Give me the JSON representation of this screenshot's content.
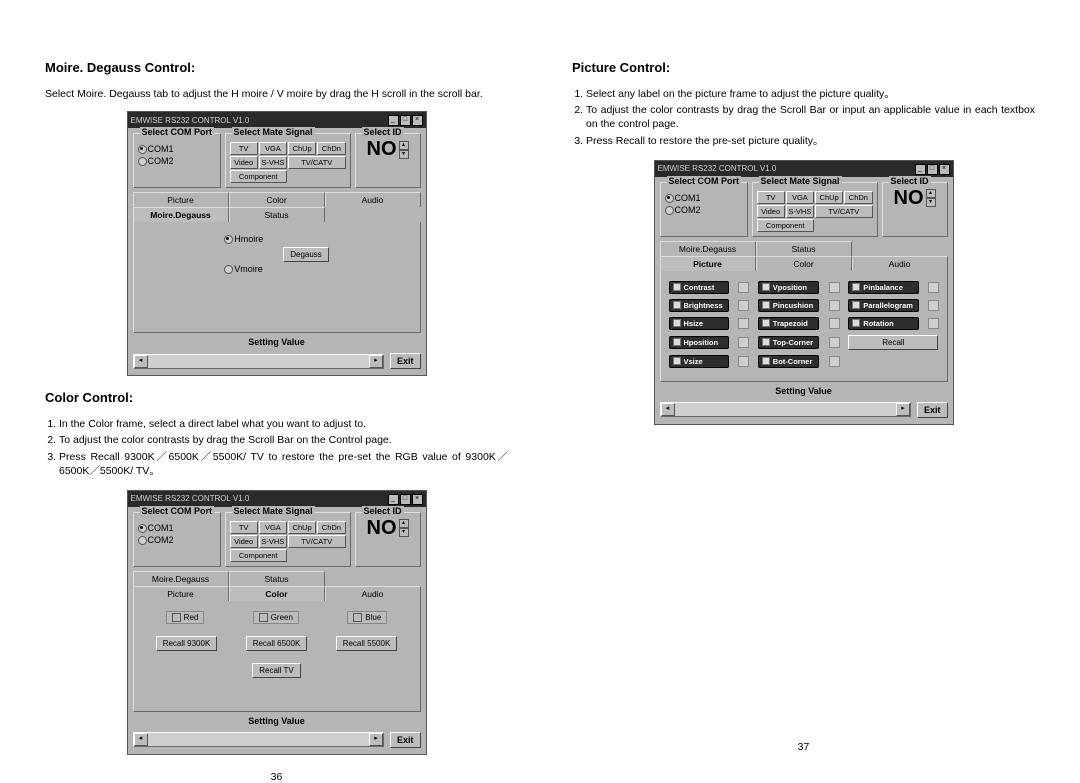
{
  "left_page": {
    "moire": {
      "heading": "Moire. Degauss Control:",
      "body": "Select Moire. Degauss tab to adjust the H moire / V moire by drag the H scroll in the scroll bar."
    },
    "color": {
      "heading": "Color Control:",
      "steps": [
        "In the Color frame, select a direct label what you want to adjust to.",
        "To adjust the color contrasts by drag the Scroll Bar on the Control page.",
        "Press Recall 9300K／6500K／5500K/ TV to restore the pre-set the RGB value of 9300K／6500K／5500K/ TV。"
      ]
    },
    "page_number": "36"
  },
  "right_page": {
    "picture": {
      "heading": "Picture Control:",
      "steps": [
        "Select any label on the picture frame to adjust the picture quality。",
        "To adjust the color contrasts by drag the Scroll Bar or input an applicable value in each textbox on the control page.",
        "Press Recall to restore the pre-set picture quality。"
      ]
    },
    "page_number": "37"
  },
  "common_window": {
    "title": "EMWISE RS232 CONTROL V1.0",
    "comport": {
      "legend": "Select COM Port",
      "opt1": "COM1",
      "opt2": "COM2"
    },
    "signal": {
      "legend": "Select Mate Signal",
      "btns": [
        "TV",
        "VGA",
        "ChUp",
        "ChDn",
        "Video",
        "S-VHS",
        "TV/CATV",
        "Component"
      ]
    },
    "selectid": {
      "legend": "Select ID",
      "value": "NO"
    },
    "tabs_row1": [
      "Moire.Degauss",
      "Status",
      ""
    ],
    "tabs_row2": [
      "Picture",
      "Color",
      "Audio"
    ],
    "setting_label": "Setting Value",
    "exit": "Exit"
  },
  "moire_tab": {
    "h": "Hmoire",
    "v": "Vmoire",
    "degauss": "Degauss"
  },
  "color_tab": {
    "colors": [
      "Red",
      "Green",
      "Blue"
    ],
    "recalls": [
      "Recall 9300K",
      "Recall 6500K",
      "Recall 5500K"
    ],
    "recall_tv": "Recall TV"
  },
  "picture_tab": {
    "col1": [
      "Contrast",
      "Brightness",
      "Hsize",
      "Hposition",
      "Vsize"
    ],
    "col2": [
      "Vposition",
      "Pincushion",
      "Trapezoid",
      "Top-Corner",
      "Bot-Corner"
    ],
    "col3": [
      "Pinbalance",
      "Parallelogram",
      "Rotation"
    ],
    "recall": "Recall"
  }
}
